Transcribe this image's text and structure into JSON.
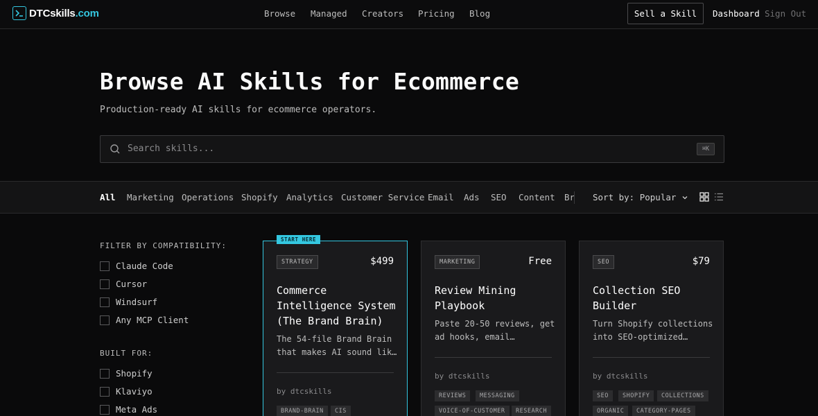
{
  "nav": {
    "logo_main": "DTCskills",
    "logo_tld": ".com",
    "links": [
      "Browse",
      "Managed",
      "Creators",
      "Pricing",
      "Blog"
    ],
    "sell_label": "Sell a Skill",
    "dashboard_label": "Dashboard",
    "signout_label": "Sign Out"
  },
  "hero": {
    "title": "Browse AI Skills for Ecommerce",
    "subtitle": "Production-ready AI skills for ecommerce operators.",
    "search_placeholder": "Search skills...",
    "shortcut": "⌘K"
  },
  "categories": {
    "items": [
      "All",
      "Marketing",
      "Operations",
      "Shopify",
      "Analytics",
      "Customer Service",
      "Email",
      "Ads",
      "SEO",
      "Content",
      "Br"
    ],
    "active": "All",
    "sort_label": "Sort by: Popular"
  },
  "filters": {
    "compat_heading": "FILTER BY COMPATIBILITY:",
    "compat_options": [
      "Claude Code",
      "Cursor",
      "Windsurf",
      "Any MCP Client"
    ],
    "built_heading": "BUILT FOR:",
    "built_options": [
      "Shopify",
      "Klaviyo",
      "Meta Ads"
    ]
  },
  "cards": [
    {
      "ribbon": "START HERE",
      "badge": "STRATEGY",
      "price": "$499",
      "title": "Commerce Intelligence System (The Brand Brain)",
      "desc": "The 54-file Brand Brain that makes AI sound lik…",
      "by": "by dtcskills",
      "tags": [
        "BRAND-BRAIN",
        "CIS"
      ]
    },
    {
      "badge": "MARKETING",
      "price": "Free",
      "title": "Review Mining Playbook",
      "desc": "Paste 20-50 reviews, get ad hooks, email…",
      "by": "by dtcskills",
      "tags": [
        "REVIEWS",
        "MESSAGING",
        "VOICE-OF-CUSTOMER",
        "RESEARCH"
      ]
    },
    {
      "badge": "SEO",
      "price": "$79",
      "title": "Collection SEO Builder",
      "desc": "Turn Shopify collections into SEO-optimized…",
      "by": "by dtcskills",
      "tags": [
        "SEO",
        "SHOPIFY",
        "COLLECTIONS",
        "ORGANIC",
        "CATEGORY-PAGES"
      ]
    }
  ],
  "colors": {
    "accent": "#34c7e0",
    "background": "#0a0a0b",
    "card": "#1a1a1c"
  }
}
